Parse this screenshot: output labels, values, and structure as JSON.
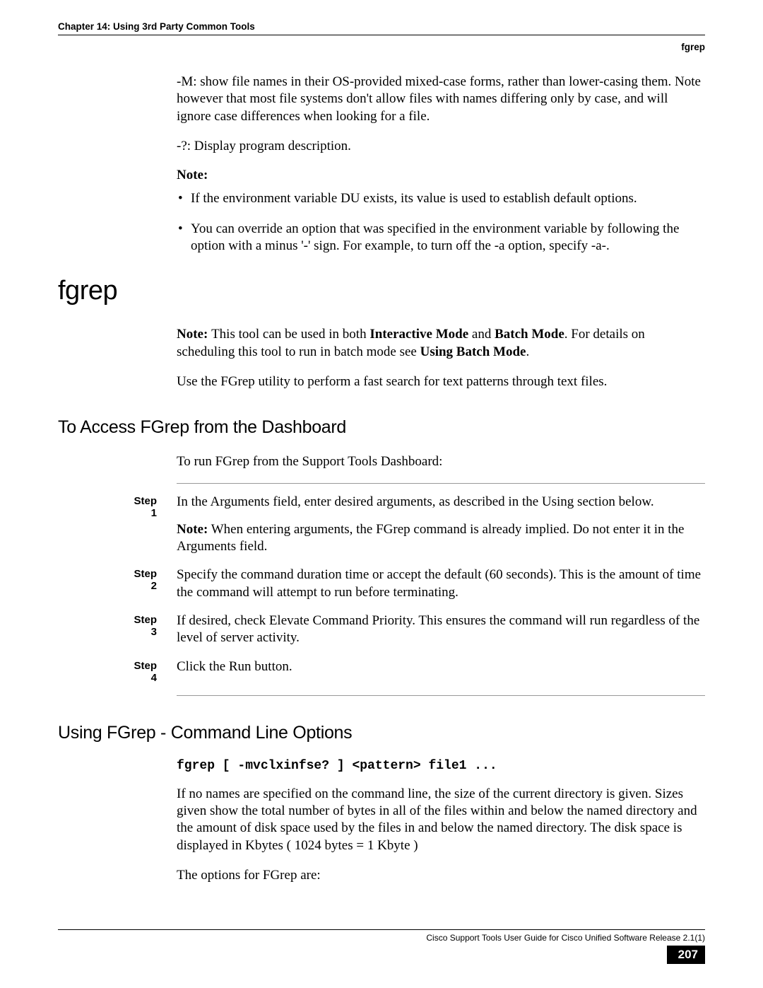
{
  "header": {
    "chapter": "Chapter 14: Using 3rd Party Common Tools",
    "section": "fgrep"
  },
  "intro": {
    "m_option": "-M: show file names in their OS-provided mixed-case forms, rather than lower-casing them. Note however that most file systems don't allow files with names differing only by case, and will ignore case differences when looking for a file.",
    "q_option": "-?: Display program description.",
    "note_label": "Note:",
    "bullet1": "If the environment variable DU exists, its value is used to establish default options.",
    "bullet2": "You can override an option that was specified in the environment variable by following the option with a minus '-' sign. For example, to turn off the -a option, specify -a-."
  },
  "fgrep": {
    "title": "fgrep",
    "note_prefix": "Note: ",
    "note_body1": "This tool can be used in both ",
    "note_bold1": "Interactive Mode",
    "note_and": " and ",
    "note_bold2": "Batch Mode",
    "note_body2": ". For details on scheduling this tool to run in batch mode see ",
    "note_bold3": "Using Batch Mode",
    "note_period": ".",
    "usage": "Use the FGrep utility to perform a fast search for text patterns through text files."
  },
  "access": {
    "title": "To Access FGrep from the Dashboard",
    "intro": "To run FGrep from the Support Tools Dashboard:",
    "steps": [
      {
        "label": "Step 1",
        "body": "In the Arguments field, enter desired arguments, as described in the Using section below.",
        "note_prefix": "Note:",
        "note_body": " When entering arguments, the FGrep command is already implied. Do not enter it in the Arguments field."
      },
      {
        "label": "Step 2",
        "body": "Specify the command duration time or accept the default (60 seconds). This is the amount of time the command will attempt to run before terminating."
      },
      {
        "label": "Step 3",
        "body": "If desired, check Elevate Command Priority. This ensures the command will run regardless of the level of server activity."
      },
      {
        "label": "Step 4",
        "body": "Click the Run button."
      }
    ]
  },
  "cmdline": {
    "title": "Using FGrep - Command Line Options",
    "code": "fgrep [ -mvclxinfse? ] <pattern> file1 ...",
    "para1": "If no names are specified on the command line, the size of the current directory is given. Sizes given show the total number of bytes in all of the files within and below the named directory and the amount of disk space used by the files in and below the named directory. The disk space is displayed in Kbytes ( 1024 bytes = 1 Kbyte )",
    "para2": "The options for FGrep are:"
  },
  "footer": {
    "title": "Cisco Support Tools User Guide for Cisco Unified Software Release 2.1(1)",
    "page": "207"
  }
}
